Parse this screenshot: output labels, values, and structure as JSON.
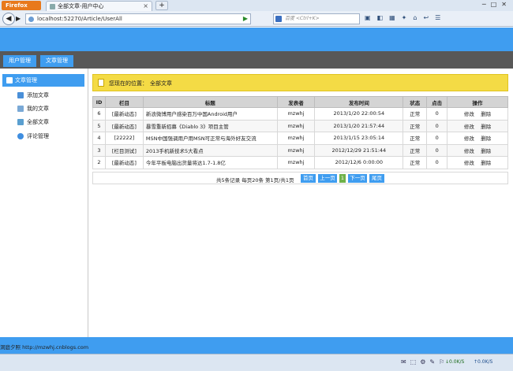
{
  "browser": {
    "app_button": "Firefox",
    "tab_title": "全部文章-用户中心",
    "tab_close": "×",
    "new_tab": "+",
    "url": "localhost:52270/Article/UserAll",
    "search_placeholder": "百度 <Ctrl+K>"
  },
  "topnav": {
    "user_mgmt": "用户管理",
    "article_mgmt": "文章管理"
  },
  "sidebar": {
    "header": "文章管理",
    "items": [
      {
        "label": "添加文章",
        "color": "#4a8fd8"
      },
      {
        "label": "我的文章",
        "color": "#7aa9d6"
      },
      {
        "label": "全部文章",
        "color": "#5a9fd0"
      },
      {
        "label": "评论管理",
        "color": "#3f8ee0"
      }
    ]
  },
  "breadcrumb": {
    "prefix": "您现在的位置：",
    "current": "全部文章"
  },
  "table": {
    "headers": [
      "ID",
      "栏目",
      "标题",
      "发表者",
      "发布时间",
      "状态",
      "点击",
      "操作"
    ],
    "rows": [
      {
        "id": "6",
        "category": "[最新动态]",
        "title": "新浪微博用户感染百万中国Android用户",
        "author": "mzwhj",
        "time": "2013/1/20 22:00:54",
        "status": "正常",
        "clicks": "0",
        "edit": "修改",
        "del": "删除"
      },
      {
        "id": "5",
        "category": "[最新动态]",
        "title": "暴雪重新招募《Diablo 3》项目主管",
        "author": "mzwhj",
        "time": "2013/1/20 21:57:44",
        "status": "正常",
        "clicks": "0",
        "edit": "修改",
        "del": "删除"
      },
      {
        "id": "4",
        "category": "[22222]",
        "title": "MSN中国强调用户用MSN可正常与海外好友交流",
        "author": "mzwhj",
        "time": "2013/1/15 23:05:14",
        "status": "正常",
        "clicks": "0",
        "edit": "修改",
        "del": "删除"
      },
      {
        "id": "3",
        "category": "[栏目测试]",
        "title": "2013手机新技术5大看点",
        "author": "mzwhj",
        "time": "2012/12/29 21:51:44",
        "status": "正常",
        "clicks": "0",
        "edit": "修改",
        "del": "删除"
      },
      {
        "id": "2",
        "category": "[最新动态]",
        "title": "今年平板电脑出货量将达1.7-1.8亿",
        "author": "mzwhj",
        "time": "2012/12/6 0:00:00",
        "status": "正常",
        "clicks": "0",
        "edit": "修改",
        "del": "删除"
      }
    ]
  },
  "pager": {
    "info": "共5条记录 每页20条 第1页/共1页",
    "first": "首页",
    "prev": "上一页",
    "current": "1",
    "next": "下一页",
    "last": "尾页"
  },
  "footer": {
    "text": "洞庭夕照 http://mzwhj.cnblogs.com"
  },
  "statusbar": {
    "down_rate": "0.0K/S",
    "up_rate": "0.0K/S"
  }
}
